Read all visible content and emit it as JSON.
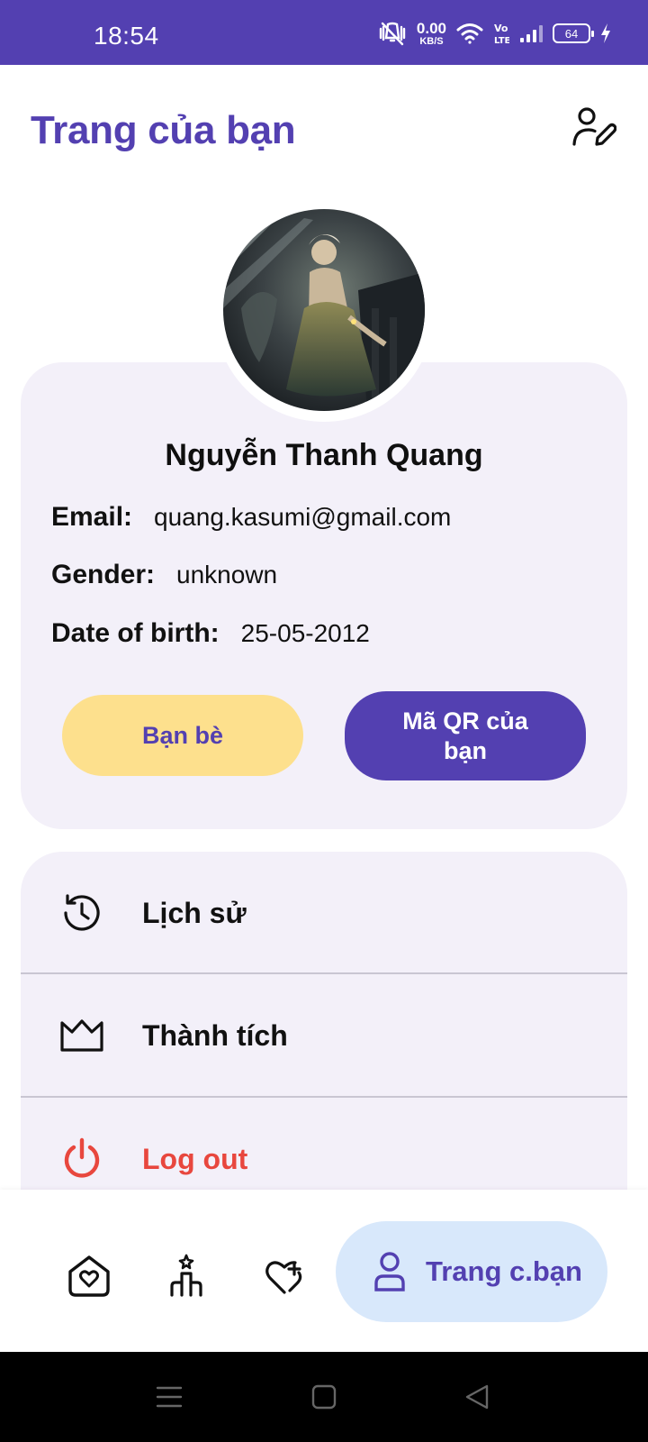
{
  "status_bar": {
    "time": "18:54",
    "net_speed_value": "0.00",
    "net_speed_unit": "KB/S",
    "battery_level": "64"
  },
  "header": {
    "title": "Trang của bạn",
    "edit_icon": "user-edit-icon"
  },
  "profile": {
    "name": "Nguyễn Thanh Quang",
    "email_label": "Email:",
    "email": "quang.kasumi@gmail.com",
    "gender_label": "Gender:",
    "gender": "unknown",
    "dob_label": "Date of birth:",
    "dob": "25-05-2012",
    "friends_button": "Bạn bè",
    "qr_button": "Mã QR của bạn"
  },
  "menu": {
    "items": [
      {
        "label": "Lịch sử",
        "icon": "history-icon"
      },
      {
        "label": "Thành tích",
        "icon": "crown-icon"
      },
      {
        "label": "Log out",
        "icon": "power-icon"
      }
    ]
  },
  "bottom_nav": {
    "items": [
      {
        "icon": "home-heart-icon"
      },
      {
        "icon": "candle-icon"
      },
      {
        "icon": "heart-plus-icon"
      }
    ],
    "active_label": "Trang c.bạn",
    "active_icon": "user-icon"
  },
  "colors": {
    "primary": "#5340b1",
    "card_bg": "#f3f0f9",
    "friends_btn": "#fde08d",
    "logout": "#e8473e",
    "active_nav_bg": "#d8e8fb"
  }
}
